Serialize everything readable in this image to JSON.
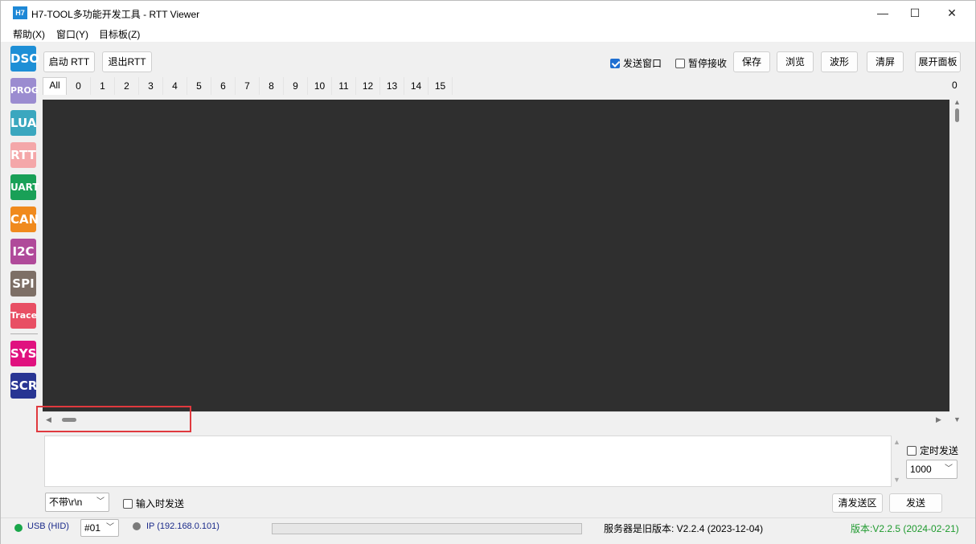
{
  "titlebar": {
    "icon_text": "H7",
    "title": "H7-TOOL多功能开发工具 - RTT Viewer",
    "minimize_glyph": "—",
    "maximize_glyph": "☐",
    "close_glyph": "✕"
  },
  "menu": {
    "items": [
      "帮助(X)",
      "窗口(Y)",
      "目标板(Z)"
    ]
  },
  "sidebar": {
    "items": [
      {
        "label": "DSO",
        "color": "#1e8fd6"
      },
      {
        "label": "PROG",
        "color": "#9b8cd0"
      },
      {
        "label": "LUA",
        "color": "#3ba7bf"
      },
      {
        "label": "RTT",
        "color": "#f4a7a9"
      },
      {
        "label": "UART",
        "color": "#19a057"
      },
      {
        "label": "CAN",
        "color": "#f08a1d"
      },
      {
        "label": "I2C",
        "color": "#b04a9a"
      },
      {
        "label": "SPI",
        "color": "#7d6f66"
      },
      {
        "label": "Trace",
        "color": "#e84f64"
      },
      {
        "label": "SYS",
        "color": "#e0117f"
      },
      {
        "label": "SCR",
        "color": "#283593"
      }
    ]
  },
  "toolbar": {
    "start_rtt": "启动 RTT",
    "exit_rtt": "退出RTT",
    "send_window_label": "发送窗口",
    "send_window_checked": true,
    "pause_recv_label": "暂停接收",
    "pause_recv_checked": false,
    "save": "保存",
    "browse": "浏览",
    "waveform": "波形",
    "clear": "清屏",
    "expand_panel": "展开面板"
  },
  "channels": {
    "tabs": [
      "All",
      "0",
      "1",
      "2",
      "3",
      "4",
      "5",
      "6",
      "7",
      "8",
      "9",
      "10",
      "11",
      "12",
      "13",
      "14",
      "15"
    ],
    "active": "All",
    "count": "0"
  },
  "send": {
    "timer_send_label": "定时发送",
    "timer_send_checked": false,
    "interval_value": "1000",
    "line_ending_value": "不带\\r\\n",
    "send_on_input_label": "输入时发送",
    "send_on_input_checked": false,
    "clear_send_area": "清发送区",
    "send_button": "发送"
  },
  "status": {
    "usb_label": "USB (HID)",
    "usb_color": "#19a64a",
    "device_value": "#01",
    "ip_label": "IP (192.168.0.101)",
    "ip_color": "#7a7a7a",
    "server_version": "服务器是旧版本: V2.2.4 (2023-12-04)",
    "app_version": "版本:V2.2.5 (2024-02-21)",
    "app_version_color": "#1e9a2e"
  },
  "highlight_color": "#e0393e"
}
